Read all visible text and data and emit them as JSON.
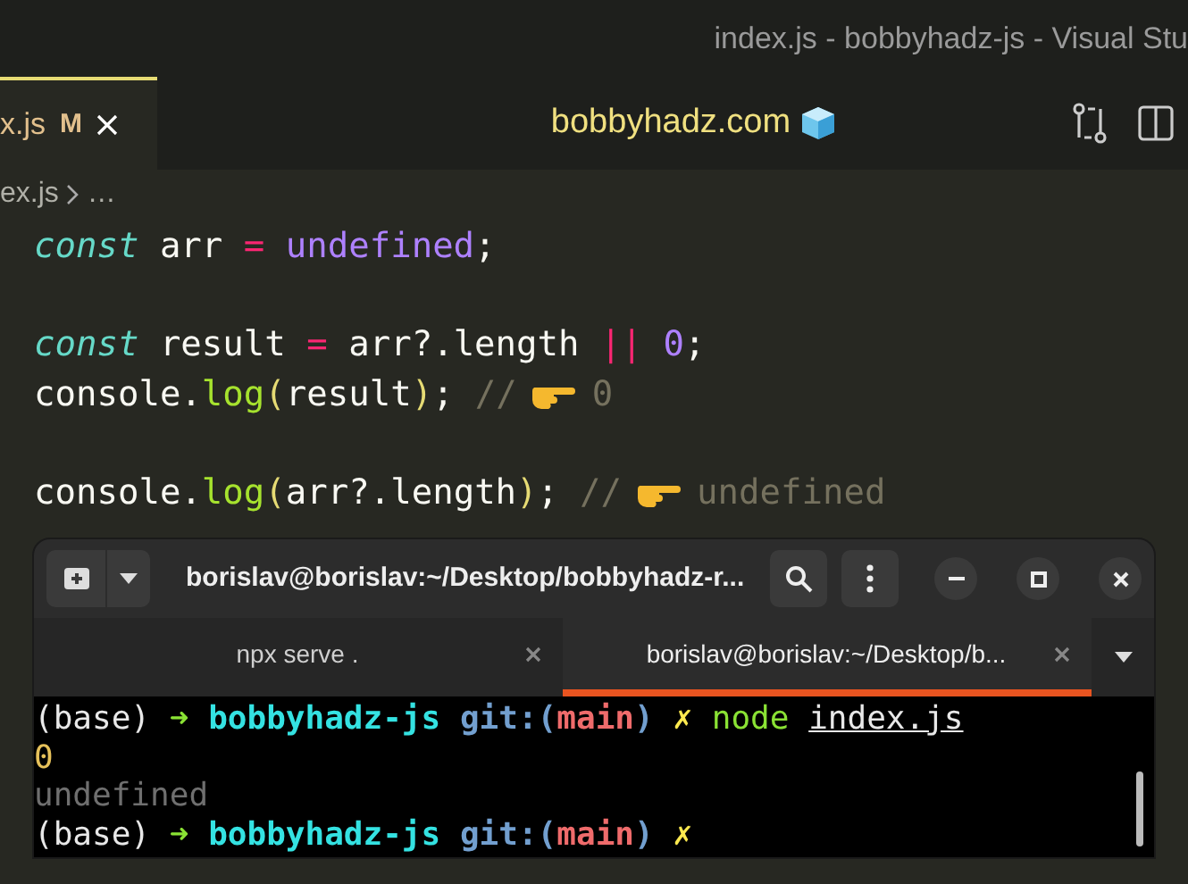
{
  "window": {
    "title": "index.js - bobbyhadz-js - Visual Stu"
  },
  "editor_tab": {
    "filename": "x.js",
    "status": "M",
    "selected": true
  },
  "banner": {
    "text": "bobbyhadz.com"
  },
  "breadcrumb": {
    "file": "ex.js",
    "rest": "…"
  },
  "code_lines": [
    {
      "kind": "code",
      "tokens": [
        {
          "text": "const",
          "kind": "keyword"
        },
        {
          "text": " arr ",
          "kind": "plain"
        },
        {
          "text": "= ",
          "kind": "operator"
        },
        {
          "text": "undefined",
          "kind": "constant"
        },
        {
          "text": ";",
          "kind": "plain"
        }
      ]
    },
    {
      "kind": "blank"
    },
    {
      "kind": "code",
      "tokens": [
        {
          "text": "const",
          "kind": "keyword"
        },
        {
          "text": " result ",
          "kind": "plain"
        },
        {
          "text": "=",
          "kind": "operator"
        },
        {
          "text": " arr?.length ",
          "kind": "plain"
        },
        {
          "text": "|| ",
          "kind": "operator"
        },
        {
          "text": "0",
          "kind": "constant"
        },
        {
          "text": ";",
          "kind": "plain"
        }
      ]
    },
    {
      "kind": "code",
      "tokens": [
        {
          "text": "console.",
          "kind": "plain"
        },
        {
          "text": "log",
          "kind": "function"
        },
        {
          "text": "(",
          "kind": "paren"
        },
        {
          "text": "result",
          "kind": "plain"
        },
        {
          "text": ")",
          "kind": "paren"
        },
        {
          "text": ";",
          "kind": "plain"
        }
      ],
      "comment": {
        "marker": "//",
        "result": "0"
      }
    },
    {
      "kind": "blank"
    },
    {
      "kind": "code",
      "tokens": [
        {
          "text": "console.",
          "kind": "plain"
        },
        {
          "text": "log",
          "kind": "function"
        },
        {
          "text": "(",
          "kind": "paren"
        },
        {
          "text": "arr?.length",
          "kind": "plain"
        },
        {
          "text": ")",
          "kind": "paren"
        },
        {
          "text": ";",
          "kind": "plain"
        }
      ],
      "comment": {
        "marker": "//",
        "result": "undefined"
      }
    }
  ],
  "terminal": {
    "title": "borislav@borislav:~/Desktop/bobbyhadz-r...",
    "tabs": [
      {
        "label": "npx serve .",
        "selected": false
      },
      {
        "label": "borislav@borislav:~/Desktop/b...",
        "selected": true
      }
    ],
    "lines": [
      [
        {
          "text": "(base)",
          "kind": "plain"
        },
        {
          "text": "➜",
          "kind": "arrow"
        },
        {
          "text": "bobbyhadz-js",
          "kind": "dir"
        },
        {
          "text": "git:(",
          "kind": "git"
        },
        {
          "text": "main",
          "kind": "branch"
        },
        {
          "text": ")",
          "kind": "git"
        },
        {
          "text": "✗",
          "kind": "dirty"
        },
        {
          "text": "node",
          "kind": "command"
        },
        {
          "text": "index.js",
          "kind": "file"
        }
      ],
      [
        {
          "text": "0",
          "kind": "number"
        }
      ],
      [
        {
          "text": "undefined",
          "kind": "muted"
        }
      ],
      [
        {
          "text": "(base)",
          "kind": "plain"
        },
        {
          "text": "➜",
          "kind": "arrow"
        },
        {
          "text": "bobbyhadz-js",
          "kind": "dir"
        },
        {
          "text": "git:(",
          "kind": "git"
        },
        {
          "text": "main",
          "kind": "branch"
        },
        {
          "text": ")",
          "kind": "git"
        },
        {
          "text": "✗",
          "kind": "dirty"
        }
      ]
    ]
  }
}
